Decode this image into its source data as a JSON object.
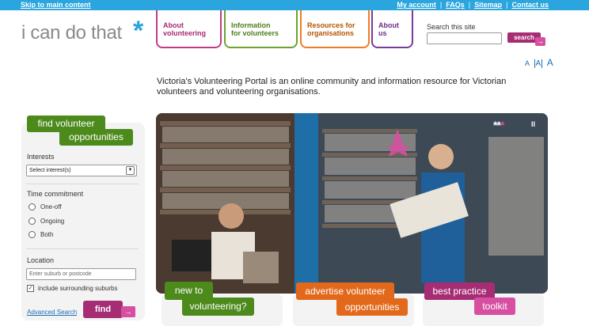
{
  "top_bar": {
    "skip_link": "Skip to main content",
    "links": [
      "My account",
      "FAQs",
      "Sitemap",
      "Contact us"
    ]
  },
  "logo": {
    "text": "i can do that",
    "accent": "*"
  },
  "nav": [
    {
      "line1": "About",
      "line2": "volunteering"
    },
    {
      "line1": "Information",
      "line2": "for volunteers"
    },
    {
      "line1": "Resources for",
      "line2": "organisations"
    },
    {
      "line1": "About",
      "line2": "us"
    }
  ],
  "search": {
    "label": "Search this site",
    "button": "search",
    "arrow": "→"
  },
  "text_size": [
    "A",
    "A",
    "A"
  ],
  "intro": "Victoria's Volunteering Portal is an online community and information resource for Victorian volunteers and volunteering organisations.",
  "sidebar": {
    "title_line1": "find volunteer",
    "title_line2": "opportunities",
    "interests_label": "Interests",
    "interests_value": "Select interest(s)",
    "time_label": "Time commitment",
    "time_options": [
      "One-off",
      "Ongoing",
      "Both"
    ],
    "location_label": "Location",
    "location_placeholder": "Enter suburb or postcode",
    "surrounding_label": "include surrounding suburbs",
    "surrounding_checked": true,
    "advanced_search": "Advanced Search",
    "find_button": "find",
    "arrow": "→"
  },
  "hero": {
    "dots": "**",
    "active_dot": "*",
    "pause": "II"
  },
  "feature_tabs": [
    {
      "line1": "new to",
      "line2": "volunteering?"
    },
    {
      "line1": "advertise volunteer",
      "line2": "opportunities"
    },
    {
      "line1": "best practice",
      "line2": "toolkit"
    }
  ],
  "colors": {
    "accent_blue": "#2aa5dd",
    "green": "#4d8a1c",
    "orange": "#e2691b",
    "magenta": "#a62d74",
    "purple": "#6a2b8a"
  }
}
